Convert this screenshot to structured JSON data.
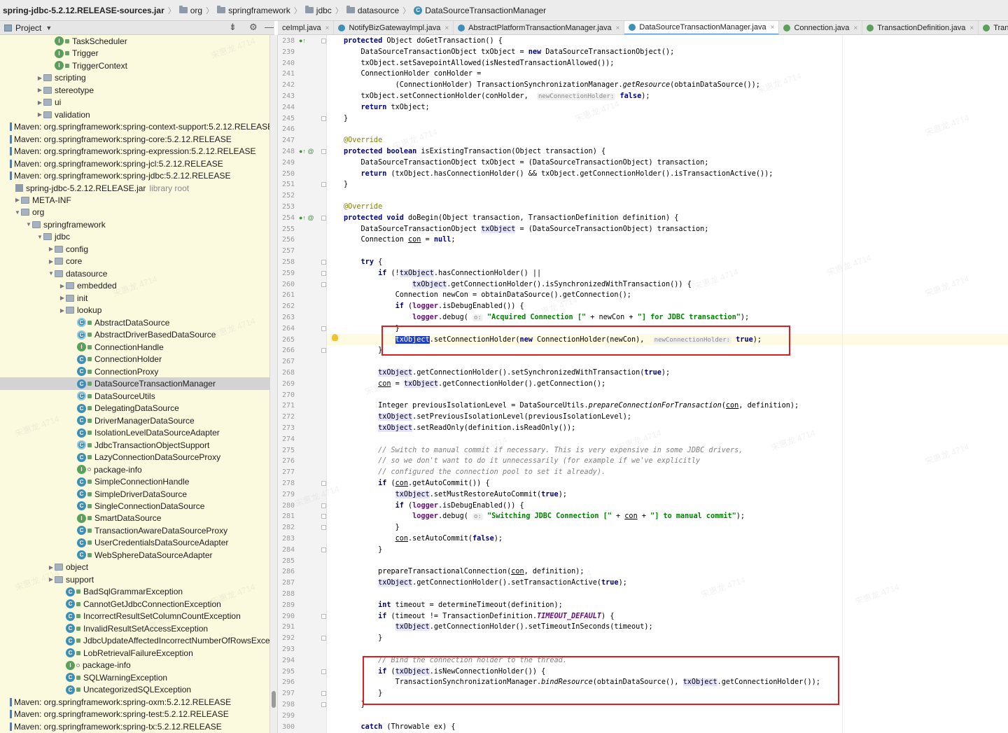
{
  "breadcrumb": [
    {
      "label": "spring-jdbc-5.2.12.RELEASE-sources.jar",
      "icon": "jar-icon"
    },
    {
      "label": "org",
      "icon": "folder-icon"
    },
    {
      "label": "springframework",
      "icon": "folder-icon"
    },
    {
      "label": "jdbc",
      "icon": "folder-icon"
    },
    {
      "label": "datasource",
      "icon": "folder-icon"
    },
    {
      "label": "DataSourceTransactionManager",
      "icon": "class-icon"
    }
  ],
  "project_panel": {
    "title": "Project"
  },
  "tree": [
    {
      "label": "TaskScheduler",
      "indent": 4,
      "icon": "iface",
      "lock": "lock"
    },
    {
      "label": "Trigger",
      "indent": 4,
      "icon": "iface",
      "lock": "lock"
    },
    {
      "label": "TriggerContext",
      "indent": 4,
      "icon": "iface",
      "lock": "lock"
    },
    {
      "label": "scripting",
      "indent": 3,
      "icon": "folder",
      "arrow": "▶"
    },
    {
      "label": "stereotype",
      "indent": 3,
      "icon": "folder",
      "arrow": "▶"
    },
    {
      "label": "ui",
      "indent": 3,
      "icon": "folder",
      "arrow": "▶"
    },
    {
      "label": "validation",
      "indent": 3,
      "icon": "folder",
      "arrow": "▶"
    },
    {
      "label": "Maven: org.springframework:spring-context-support:5.2.12.RELEASE",
      "indent": 0,
      "icon": "bars"
    },
    {
      "label": "Maven: org.springframework:spring-core:5.2.12.RELEASE",
      "indent": 0,
      "icon": "bars"
    },
    {
      "label": "Maven: org.springframework:spring-expression:5.2.12.RELEASE",
      "indent": 0,
      "icon": "bars"
    },
    {
      "label": "Maven: org.springframework:spring-jcl:5.2.12.RELEASE",
      "indent": 0,
      "icon": "bars"
    },
    {
      "label": "Maven: org.springframework:spring-jdbc:5.2.12.RELEASE",
      "indent": 0,
      "icon": "bars"
    },
    {
      "label": "spring-jdbc-5.2.12.RELEASE.jar",
      "indent": 0.5,
      "icon": "lib",
      "suffix": "library root"
    },
    {
      "label": "META-INF",
      "indent": 1,
      "icon": "folder",
      "arrow": "▶"
    },
    {
      "label": "org",
      "indent": 1,
      "icon": "folder",
      "arrow": "▼"
    },
    {
      "label": "springframework",
      "indent": 2,
      "icon": "folder",
      "arrow": "▼"
    },
    {
      "label": "jdbc",
      "indent": 3,
      "icon": "folder",
      "arrow": "▼"
    },
    {
      "label": "config",
      "indent": 4,
      "icon": "folder",
      "arrow": "▶"
    },
    {
      "label": "core",
      "indent": 4,
      "icon": "folder",
      "arrow": "▶"
    },
    {
      "label": "datasource",
      "indent": 4,
      "icon": "folder",
      "arrow": "▼"
    },
    {
      "label": "embedded",
      "indent": 5,
      "icon": "folder",
      "arrow": "▶"
    },
    {
      "label": "init",
      "indent": 5,
      "icon": "folder",
      "arrow": "▶"
    },
    {
      "label": "lookup",
      "indent": 5,
      "icon": "folder",
      "arrow": "▶"
    },
    {
      "label": "AbstractDataSource",
      "indent": 6,
      "icon": "acls",
      "lock": "lock"
    },
    {
      "label": "AbstractDriverBasedDataSource",
      "indent": 6,
      "icon": "acls",
      "lock": "lock"
    },
    {
      "label": "ConnectionHandle",
      "indent": 6,
      "icon": "iface",
      "lock": "lock"
    },
    {
      "label": "ConnectionHolder",
      "indent": 6,
      "icon": "cls",
      "lock": "lock"
    },
    {
      "label": "ConnectionProxy",
      "indent": 6,
      "icon": "cls",
      "lock": "lock"
    },
    {
      "label": "DataSourceTransactionManager",
      "indent": 6,
      "icon": "cls",
      "lock": "lock",
      "selected": true
    },
    {
      "label": "DataSourceUtils",
      "indent": 6,
      "icon": "acls",
      "lock": "lock"
    },
    {
      "label": "DelegatingDataSource",
      "indent": 6,
      "icon": "cls",
      "lock": "lock"
    },
    {
      "label": "DriverManagerDataSource",
      "indent": 6,
      "icon": "cls",
      "lock": "lock"
    },
    {
      "label": "IsolationLevelDataSourceAdapter",
      "indent": 6,
      "icon": "cls",
      "lock": "lock"
    },
    {
      "label": "JdbcTransactionObjectSupport",
      "indent": 6,
      "icon": "acls",
      "lock": "lock"
    },
    {
      "label": "LazyConnectionDataSourceProxy",
      "indent": 6,
      "icon": "cls",
      "lock": "lock"
    },
    {
      "label": "package-info",
      "indent": 6,
      "icon": "pkg",
      "lock": "circle"
    },
    {
      "label": "SimpleConnectionHandle",
      "indent": 6,
      "icon": "cls",
      "lock": "lock"
    },
    {
      "label": "SimpleDriverDataSource",
      "indent": 6,
      "icon": "cls",
      "lock": "lock"
    },
    {
      "label": "SingleConnectionDataSource",
      "indent": 6,
      "icon": "cls",
      "lock": "lock"
    },
    {
      "label": "SmartDataSource",
      "indent": 6,
      "icon": "iface",
      "lock": "lock"
    },
    {
      "label": "TransactionAwareDataSourceProxy",
      "indent": 6,
      "icon": "cls",
      "lock": "lock"
    },
    {
      "label": "UserCredentialsDataSourceAdapter",
      "indent": 6,
      "icon": "cls",
      "lock": "lock"
    },
    {
      "label": "WebSphereDataSourceAdapter",
      "indent": 6,
      "icon": "cls",
      "lock": "lock"
    },
    {
      "label": "object",
      "indent": 4,
      "icon": "folder",
      "arrow": "▶"
    },
    {
      "label": "support",
      "indent": 4,
      "icon": "folder",
      "arrow": "▶"
    },
    {
      "label": "BadSqlGrammarException",
      "indent": 5,
      "icon": "exc",
      "lock": "lock"
    },
    {
      "label": "CannotGetJdbcConnectionException",
      "indent": 5,
      "icon": "exc",
      "lock": "lock"
    },
    {
      "label": "IncorrectResultSetColumnCountException",
      "indent": 5,
      "icon": "exc",
      "lock": "lock"
    },
    {
      "label": "InvalidResultSetAccessException",
      "indent": 5,
      "icon": "exc",
      "lock": "lock"
    },
    {
      "label": "JdbcUpdateAffectedIncorrectNumberOfRowsException",
      "indent": 5,
      "icon": "exc",
      "lock": "lock"
    },
    {
      "label": "LobRetrievalFailureException",
      "indent": 5,
      "icon": "exc",
      "lock": "lock"
    },
    {
      "label": "package-info",
      "indent": 5,
      "icon": "pkg",
      "lock": "circle"
    },
    {
      "label": "SQLWarningException",
      "indent": 5,
      "icon": "exc",
      "lock": "lock"
    },
    {
      "label": "UncategorizedSQLException",
      "indent": 5,
      "icon": "exc",
      "lock": "lock"
    },
    {
      "label": "Maven: org.springframework:spring-oxm:5.2.12.RELEASE",
      "indent": 0,
      "icon": "bars"
    },
    {
      "label": "Maven: org.springframework:spring-test:5.2.12.RELEASE",
      "indent": 0,
      "icon": "bars"
    },
    {
      "label": "Maven: org.springframework:spring-tx:5.2.12.RELEASE",
      "indent": 0,
      "icon": "bars"
    }
  ],
  "tabs": [
    {
      "label": "ceImpl.java",
      "icon": "",
      "active": false
    },
    {
      "label": "NotifyBizGatewayImpl.java",
      "icon": "c",
      "active": false
    },
    {
      "label": "AbstractPlatformTransactionManager.java",
      "icon": "c",
      "active": false
    },
    {
      "label": "DataSourceTransactionManager.java",
      "icon": "c",
      "active": true
    },
    {
      "label": "Connection.java",
      "icon": "i",
      "active": false
    },
    {
      "label": "TransactionDefinition.java",
      "icon": "i",
      "active": false
    },
    {
      "label": "Transa",
      "icon": "i",
      "active": false
    }
  ],
  "code_lines": [
    {
      "n": "238",
      "mark": "●↑",
      "html": "<span class=\"kw\">protected</span> Object doGetTransaction() {"
    },
    {
      "n": "239",
      "html": "    DataSourceTransactionObject txObject = <span class=\"kw\">new</span> DataSourceTransactionObject();"
    },
    {
      "n": "240",
      "html": "    txObject.setSavepointAllowed(isNestedTransactionAllowed());"
    },
    {
      "n": "241",
      "html": "    ConnectionHolder conHolder ="
    },
    {
      "n": "242",
      "html": "            (ConnectionHolder) TransactionSynchronizationManager.<span class=\"it\">getResource</span>(obtainDataSource());"
    },
    {
      "n": "243",
      "html": "    txObject.setConnectionHolder(conHolder,  <span class=\"hint\">newConnectionHolder:</span> <span class=\"kw\">false</span>);"
    },
    {
      "n": "244",
      "html": "    <span class=\"kw\">return</span> txObject;"
    },
    {
      "n": "245",
      "html": "}"
    },
    {
      "n": "246",
      "html": ""
    },
    {
      "n": "247",
      "html": "<span class=\"an\">@Override</span>"
    },
    {
      "n": "248",
      "mark": "●↑ @",
      "html": "<span class=\"kw\">protected boolean</span> isExistingTransaction(Object transaction) {"
    },
    {
      "n": "249",
      "html": "    DataSourceTransactionObject txObject = (DataSourceTransactionObject) transaction;"
    },
    {
      "n": "250",
      "html": "    <span class=\"kw\">return</span> (txObject.hasConnectionHolder() &amp;&amp; txObject.getConnectionHolder().isTransactionActive());"
    },
    {
      "n": "251",
      "html": "}"
    },
    {
      "n": "252",
      "html": ""
    },
    {
      "n": "253",
      "html": "<span class=\"an\">@Override</span>"
    },
    {
      "n": "254",
      "mark": "●↑ @",
      "html": "<span class=\"kw\">protected void</span> doBegin(Object transaction, TransactionDefinition definition) {"
    },
    {
      "n": "255",
      "html": "    DataSourceTransactionObject <span class=\"hl\">txObject</span> = (DataSourceTransactionObject) transaction;"
    },
    {
      "n": "256",
      "html": "    Connection <span class=\"ul\">con</span> = <span class=\"kw\">null</span>;"
    },
    {
      "n": "257",
      "html": ""
    },
    {
      "n": "258",
      "html": "    <span class=\"kw\">try</span> {"
    },
    {
      "n": "259",
      "html": "        <span class=\"kw\">if</span> (!<span class=\"hl\">txObject</span>.hasConnectionHolder() ||"
    },
    {
      "n": "260",
      "html": "                <span class=\"hl\">txObject</span>.getConnectionHolder().isSynchronizedWithTransaction()) {"
    },
    {
      "n": "261",
      "html": "            Connection newCon = obtainDataSource().getConnection();"
    },
    {
      "n": "262",
      "html": "            <span class=\"kw\">if</span> (<span class=\"cst\" style=\"font-style:normal\">logger</span>.isDebugEnabled()) {"
    },
    {
      "n": "263",
      "html": "                <span class=\"cst\" style=\"font-style:normal\">logger</span>.debug( <span class=\"hint\">o:</span> <span class=\"st\">\"Acquired Connection [\"</span> + newCon + <span class=\"st\">\"] for JDBC transaction\"</span>);"
    },
    {
      "n": "264",
      "html": "            }"
    },
    {
      "n": "265",
      "html": "            <span class=\"hlsel\">txObject</span>.setConnectionHolder(<span class=\"kw\">new</span> ConnectionHolder(newCon),  <span class=\"hint\">newConnectionHolder:</span> <span class=\"kw\">true</span>);"
    },
    {
      "n": "266",
      "html": "        }"
    },
    {
      "n": "267",
      "html": ""
    },
    {
      "n": "268",
      "html": "        <span class=\"hl\">txObject</span>.getConnectionHolder().setSynchronizedWithTransaction(<span class=\"kw\">true</span>);"
    },
    {
      "n": "269",
      "html": "        <span class=\"ul\">con</span> = <span class=\"hl\">txObject</span>.getConnectionHolder().getConnection();"
    },
    {
      "n": "270",
      "html": ""
    },
    {
      "n": "271",
      "html": "        Integer previousIsolationLevel = DataSourceUtils.<span class=\"it\">prepareConnectionForTransaction</span>(<span class=\"ul\">con</span>, definition);"
    },
    {
      "n": "272",
      "html": "        <span class=\"hl\">txObject</span>.setPreviousIsolationLevel(previousIsolationLevel);"
    },
    {
      "n": "273",
      "html": "        <span class=\"hl\">txObject</span>.setReadOnly(definition.isReadOnly());"
    },
    {
      "n": "274",
      "html": ""
    },
    {
      "n": "275",
      "html": "        <span class=\"cm\">// Switch to manual commit if necessary. This is very expensive in some JDBC drivers,</span>"
    },
    {
      "n": "276",
      "html": "        <span class=\"cm\">// so we don't want to do it unnecessarily (for example if we've explicitly</span>"
    },
    {
      "n": "277",
      "html": "        <span class=\"cm\">// configured the connection pool to set it already).</span>"
    },
    {
      "n": "278",
      "html": "        <span class=\"kw\">if</span> (<span class=\"ul\">con</span>.getAutoCommit()) {"
    },
    {
      "n": "279",
      "html": "            <span class=\"hl\">txObject</span>.setMustRestoreAutoCommit(<span class=\"kw\">true</span>);"
    },
    {
      "n": "280",
      "html": "            <span class=\"kw\">if</span> (<span class=\"cst\" style=\"font-style:normal\">logger</span>.isDebugEnabled()) {"
    },
    {
      "n": "281",
      "html": "                <span class=\"cst\" style=\"font-style:normal\">logger</span>.debug( <span class=\"hint\">o:</span> <span class=\"st\">\"Switching JDBC Connection [\"</span> + <span class=\"ul\">con</span> + <span class=\"st\">\"] to manual commit\"</span>);"
    },
    {
      "n": "282",
      "html": "            }"
    },
    {
      "n": "283",
      "html": "            <span class=\"ul\">con</span>.setAutoCommit(<span class=\"kw\">false</span>);"
    },
    {
      "n": "284",
      "html": "        }"
    },
    {
      "n": "285",
      "html": ""
    },
    {
      "n": "286",
      "html": "        prepareTransactionalConnection(<span class=\"ul\">con</span>, definition);"
    },
    {
      "n": "287",
      "html": "        <span class=\"hl\">txObject</span>.getConnectionHolder().setTransactionActive(<span class=\"kw\">true</span>);"
    },
    {
      "n": "288",
      "html": ""
    },
    {
      "n": "289",
      "html": "        <span class=\"kw\">int</span> timeout = determineTimeout(definition);"
    },
    {
      "n": "290",
      "html": "        <span class=\"kw\">if</span> (timeout != TransactionDefinition.<span class=\"cst\">TIMEOUT_DEFAULT</span>) {"
    },
    {
      "n": "291",
      "html": "            <span class=\"hl\">txObject</span>.getConnectionHolder().setTimeoutInSeconds(timeout);"
    },
    {
      "n": "292",
      "html": "        }"
    },
    {
      "n": "293",
      "html": ""
    },
    {
      "n": "294",
      "html": "        <span class=\"cm\">// Bind the connection holder to the thread.</span>"
    },
    {
      "n": "295",
      "html": "        <span class=\"kw\">if</span> (<span class=\"hl\">txObject</span>.isNewConnectionHolder()) {"
    },
    {
      "n": "296",
      "html": "            TransactionSynchronizationManager.<span class=\"it\">bindResource</span>(obtainDataSource(), <span class=\"hl\">txObject</span>.getConnectionHolder());"
    },
    {
      "n": "297",
      "html": "        }"
    },
    {
      "n": "298",
      "html": "    }"
    },
    {
      "n": "299",
      "html": ""
    },
    {
      "n": "300",
      "html": "    <span class=\"kw\">catch</span> (Throwable ex) {"
    }
  ],
  "watermark": "宋惠龙 4714"
}
